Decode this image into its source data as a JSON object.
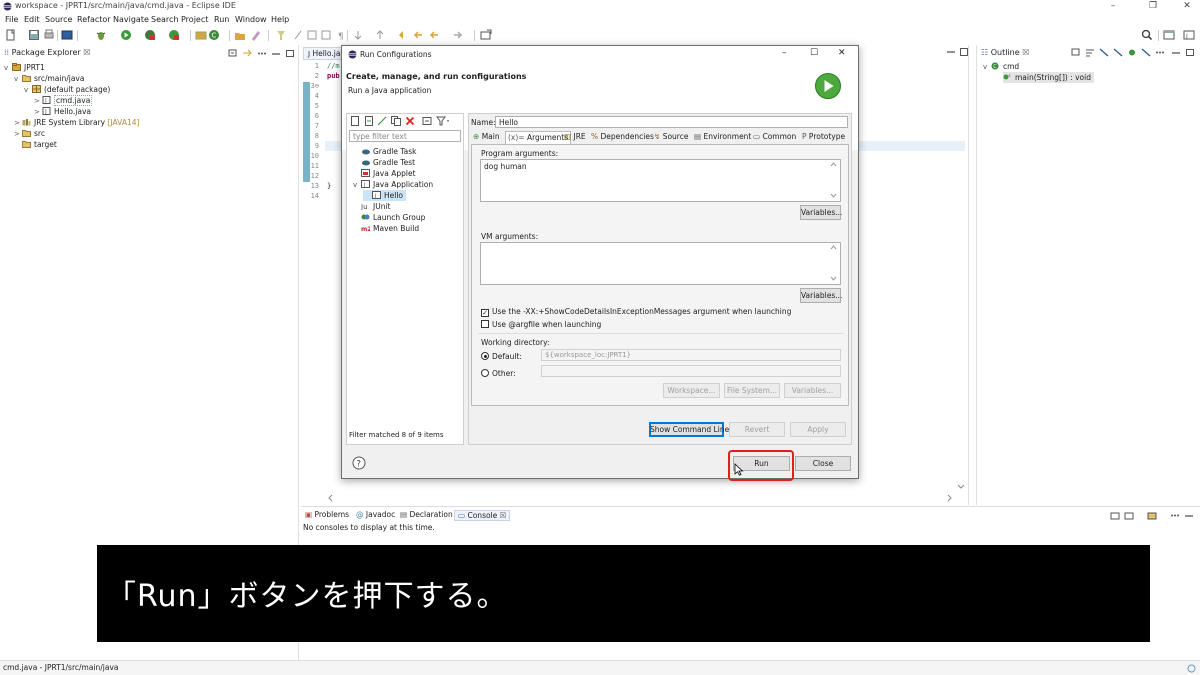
{
  "window": {
    "title": "workspace - JPRT1/src/main/java/cmd.java - Eclipse IDE",
    "controls": [
      "–",
      "❐",
      "✕"
    ]
  },
  "menu": [
    "File",
    "Edit",
    "Source",
    "Refactor",
    "Navigate",
    "Search",
    "Project",
    "Run",
    "Window",
    "Help"
  ],
  "toolbar": {
    "icons": [
      "new-icon",
      "save-icon",
      "print-icon",
      "console-icon",
      "debug-icon",
      "run-icon",
      "coverage-icon",
      "external-tools-icon",
      "new-java-class-icon",
      "open-type-icon",
      "search-icon",
      "annotation-icon",
      "back-icon",
      "forward-icon",
      "open-perspective-icon"
    ]
  },
  "package_explorer": {
    "tab_label": "Package Explorer",
    "close_glyph": "☒",
    "tree": [
      {
        "label": "JPRT1",
        "suffix": "",
        "icon": "project-icon",
        "twisty": "v"
      },
      {
        "label": "src/main/java",
        "suffix": "",
        "icon": "source-folder-icon",
        "twisty": "v"
      },
      {
        "label": "(default package)",
        "suffix": "",
        "icon": "package-icon",
        "twisty": "v"
      },
      {
        "label": "cmd.java",
        "suffix": "",
        "icon": "java-file-icon",
        "twisty": ">"
      },
      {
        "label": "Hello.java",
        "suffix": "",
        "icon": "java-file-icon",
        "twisty": ">"
      },
      {
        "label": "JRE System Library",
        "suffix": "[JAVA14]",
        "icon": "library-icon",
        "twisty": ">"
      },
      {
        "label": "src",
        "suffix": "",
        "icon": "folder-icon",
        "twisty": ">"
      },
      {
        "label": "target",
        "suffix": "",
        "icon": "folder-icon",
        "twisty": ""
      }
    ]
  },
  "editor": {
    "tab_label": "Hello.ja",
    "lines": [
      {
        "n": "1",
        "code": "//m"
      },
      {
        "n": "2",
        "code": "pub"
      },
      {
        "n": "3⊖",
        "code": ""
      },
      {
        "n": "4",
        "code": ""
      },
      {
        "n": "5",
        "code": ""
      },
      {
        "n": "6",
        "code": ""
      },
      {
        "n": "7",
        "code": ""
      },
      {
        "n": "8",
        "code": ""
      },
      {
        "n": "9",
        "code": ""
      },
      {
        "n": "10",
        "code": ""
      },
      {
        "n": "11",
        "code": ""
      },
      {
        "n": "12",
        "code": ""
      },
      {
        "n": "13",
        "code": "}"
      },
      {
        "n": "14",
        "code": ""
      }
    ]
  },
  "outline": {
    "tab_label": "Outline",
    "class_label": "cmd",
    "method_label": "main(String[]) : void"
  },
  "console": {
    "tabs": [
      "Problems",
      "Javadoc",
      "Declaration",
      "Console"
    ],
    "message": "No consoles to display at this time."
  },
  "status_bar": {
    "text": "cmd.java - JPRT1/src/main/java"
  },
  "dialog": {
    "title": "Run Configurations",
    "header_title": "Create, manage, and run configurations",
    "header_subtitle": "Run a Java application",
    "filter_placeholder": "type filter text",
    "filter_status": "Filter matched 8 of 9 items",
    "config_tree": [
      {
        "label": "Gradle Task",
        "icon": "gradle-icon",
        "indent": 1,
        "twisty": ""
      },
      {
        "label": "Gradle Test",
        "icon": "gradle-icon",
        "indent": 1,
        "twisty": ""
      },
      {
        "label": "Java Applet",
        "icon": "applet-icon",
        "indent": 1,
        "twisty": ""
      },
      {
        "label": "Java Application",
        "icon": "java-app-icon",
        "indent": 1,
        "twisty": "v"
      },
      {
        "label": "Hello",
        "icon": "java-app-icon",
        "indent": 2,
        "twisty": ""
      },
      {
        "label": "JUnit",
        "icon": "junit-icon",
        "indent": 1,
        "twisty": ""
      },
      {
        "label": "Launch Group",
        "icon": "launch-group-icon",
        "indent": 1,
        "twisty": ""
      },
      {
        "label": "Maven Build",
        "icon": "maven-icon",
        "indent": 1,
        "twisty": ""
      }
    ],
    "name_label": "Name:",
    "name_value": "Hello",
    "tabs": [
      {
        "label": "Main",
        "icon": "main-tab-icon"
      },
      {
        "label": "Arguments",
        "icon": "arguments-tab-icon"
      },
      {
        "label": "JRE",
        "icon": "jre-tab-icon"
      },
      {
        "label": "Dependencies",
        "icon": "dependencies-tab-icon"
      },
      {
        "label": "Source",
        "icon": "source-tab-icon"
      },
      {
        "label": "Environment",
        "icon": "environment-tab-icon"
      },
      {
        "label": "Common",
        "icon": "common-tab-icon"
      },
      {
        "label": "Prototype",
        "icon": "prototype-tab-icon"
      }
    ],
    "program_args_label": "Program arguments:",
    "program_args_value": "dog human",
    "variables_label": "Variables...",
    "vm_args_label": "VM arguments:",
    "vm_args_value": "",
    "show_code_details_label": "Use the -XX:+ShowCodeDetailsInExceptionMessages argument when launching",
    "show_code_details_checked": true,
    "argfile_label": "Use @argfile when launching",
    "argfile_checked": false,
    "working_dir_label": "Working directory:",
    "default_label": "Default:",
    "default_value": "${workspace_loc:JPRT1}",
    "other_label": "Other:",
    "workspace_btn": "Workspace...",
    "filesystem_btn": "File System...",
    "wd_variables_btn": "Variables...",
    "show_command_line": "Show Command Line",
    "revert": "Revert",
    "apply": "Apply",
    "run": "Run",
    "close": "Close",
    "help_glyph": "?",
    "highlight_color": "#e02020"
  },
  "caption": {
    "text": "「Run」ボタンを押下する。"
  }
}
